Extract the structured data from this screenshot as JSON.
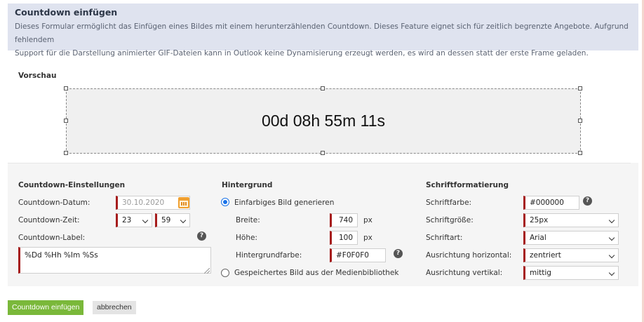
{
  "info": {
    "title": "Countdown einfügen",
    "line1": "Dieses Formular ermöglicht das Einfügen eines Bildes mit einem herunterzählenden Countdown. Dieses Feature eignet sich für zeitlich begrenzte Angebote. Aufgrund fehlendem",
    "line2": "Support für die Darstellung animierter GIF-Dateien kann in Outlook keine Dynamisierung erzeugt werden, es wird an dessen statt der erste Frame geladen."
  },
  "preview": {
    "label": "Vorschau",
    "countdown_text": "00d 08h 55m 11s",
    "background": "#F0F0F0"
  },
  "countdown_settings": {
    "title": "Countdown-Einstellungen",
    "date_label": "Countdown-Datum:",
    "date_value": "30.10.2020",
    "time_label": "Countdown-Zeit:",
    "hour_value": "23",
    "minute_value": "59",
    "label_label": "Countdown-Label:",
    "label_value": "%Dd %Hh %Im %Ss",
    "help_glyph": "?"
  },
  "background": {
    "title": "Hintergrund",
    "option_generate": "Einfarbiges Bild generieren",
    "width_label": "Breite:",
    "width_value": "740",
    "width_unit": "px",
    "height_label": "Höhe:",
    "height_value": "100",
    "height_unit": "px",
    "color_label": "Hintergrundfarbe:",
    "color_value": "#F0F0F0",
    "option_library": "Gespeichertes Bild aus der Medienbibliothek",
    "help_glyph": "?"
  },
  "font": {
    "title": "Schriftformatierung",
    "color_label": "Schriftfarbe:",
    "color_value": "#000000",
    "size_label": "Schriftgröße:",
    "size_value": "25px",
    "family_label": "Schriftart:",
    "family_value": "Arial",
    "halign_label": "Ausrichtung horizontal:",
    "halign_value": "zentriert",
    "valign_label": "Ausrichtung vertikal:",
    "valign_value": "mittig",
    "help_glyph": "?"
  },
  "actions": {
    "insert_label": "Countdown einfügen",
    "cancel_label": "abbrechen"
  },
  "colors": {
    "accent_green": "#7AB83A",
    "required_marker": "#A61C1C",
    "radio_selected": "#1A73E8"
  },
  "icons": {
    "calendar": "calendar-icon",
    "help": "help-icon",
    "chevron": "chevron-down-icon"
  }
}
